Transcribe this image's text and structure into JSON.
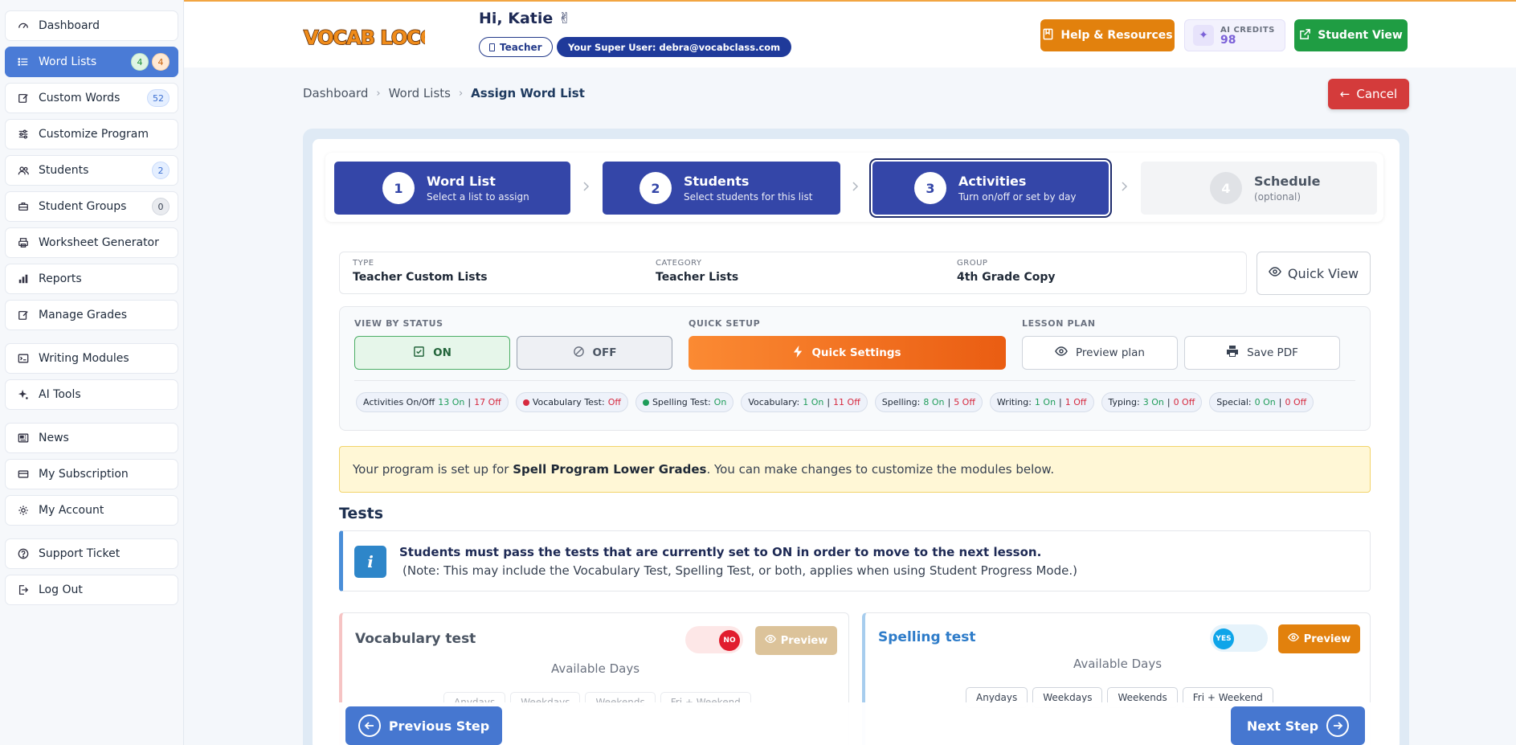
{
  "sidebar": {
    "items": [
      {
        "label": "Dashboard",
        "icon": "dashboard-icon"
      },
      {
        "label": "Word Lists",
        "icon": "list-icon",
        "badges": [
          "4",
          "4"
        ]
      },
      {
        "label": "Custom Words",
        "icon": "edit-icon",
        "badges": [
          "52"
        ]
      },
      {
        "label": "Customize Program",
        "icon": "sliders-icon"
      },
      {
        "label": "Students",
        "icon": "users-icon",
        "badges": [
          "2"
        ]
      },
      {
        "label": "Student Groups",
        "icon": "briefcase-icon",
        "badges": [
          "0"
        ]
      },
      {
        "label": "Worksheet Generator",
        "icon": "printer-icon"
      },
      {
        "label": "Reports",
        "icon": "bar-chart-icon"
      },
      {
        "label": "Manage Grades",
        "icon": "edit-icon"
      },
      {
        "label": "Writing Modules",
        "icon": "terminal-icon"
      },
      {
        "label": "AI Tools",
        "icon": "sparkle-icon"
      },
      {
        "label": "News",
        "icon": "newspaper-icon"
      },
      {
        "label": "My Subscription",
        "icon": "credit-card-icon"
      },
      {
        "label": "My Account",
        "icon": "gear-icon"
      },
      {
        "label": "Support Ticket",
        "icon": "question-icon"
      },
      {
        "label": "Log Out",
        "icon": "logout-icon"
      }
    ]
  },
  "header": {
    "logo_text": "VOCAB LOCO",
    "greeting": "Hi, Katie ✌",
    "role": "Teacher",
    "super_user": "Your Super User:  debra@vocabclass.com",
    "help_label": "Help & Resources",
    "credits_label": "AI CREDITS",
    "credits_value": "98",
    "student_view_label": "Student View"
  },
  "breadcrumb": [
    "Dashboard",
    "Word Lists",
    "Assign Word List"
  ],
  "cancel_label": "Cancel",
  "steps": [
    {
      "num": "1",
      "title": "Word List",
      "sub": "Select a list to assign"
    },
    {
      "num": "2",
      "title": "Students",
      "sub": "Select students for this list"
    },
    {
      "num": "3",
      "title": "Activities",
      "sub": "Turn on/off or set by day"
    },
    {
      "num": "4",
      "title": "Schedule",
      "sub": "(optional)"
    }
  ],
  "info": {
    "type_label": "TYPE",
    "type_value": "Teacher Custom Lists",
    "category_label": "CATEGORY",
    "category_value": "Teacher Lists",
    "group_label": "GROUP",
    "group_value": "4th Grade Copy",
    "quick_view_label": "Quick View"
  },
  "controls": {
    "view_status_label": "VIEW BY STATUS",
    "on_label": "ON",
    "off_label": "OFF",
    "quick_setup_label": "QUICK SETUP",
    "quick_settings_label": "Quick Settings",
    "lesson_plan_label": "LESSON PLAN",
    "preview_plan_label": "Preview plan",
    "save_pdf_label": "Save PDF"
  },
  "chips": [
    {
      "name": "Activities On/Off",
      "on": "13 On",
      "off": "17 Off"
    },
    {
      "name": "Vocabulary Test:",
      "status": "Off",
      "color": "#d6293f"
    },
    {
      "name": "Spelling Test:",
      "status": "On",
      "color": "#1f9d5a"
    },
    {
      "name": "Vocabulary:",
      "on": "1 On",
      "off": "11 Off"
    },
    {
      "name": "Spelling:",
      "on": "8 On",
      "off": "5 Off"
    },
    {
      "name": "Writing:",
      "on": "1 On",
      "off": "1 Off"
    },
    {
      "name": "Typing:",
      "on": "3 On",
      "off": "0 Off"
    },
    {
      "name": "Special:",
      "on": "0 On",
      "off": "0 Off"
    }
  ],
  "notice": {
    "prefix": "Your program is set up for ",
    "program": "Spell Program Lower Grades",
    "suffix": ". You can make changes to customize the modules below."
  },
  "tests_title": "Tests",
  "alert": {
    "line1": "Students must pass the tests that are currently set to ON in order to move to the next lesson.",
    "line2": "(Note: This may include the Vocabulary Test, Spelling Test, or both, applies when using Student Progress Mode.)"
  },
  "vocab_test": {
    "title": "Vocabulary test",
    "toggle": "NO",
    "preview": "Preview",
    "available": "Available Days",
    "days": [
      "Anydays",
      "Weekdays",
      "Weekends",
      "Fri + Weekend"
    ]
  },
  "spell_test": {
    "title": "Spelling test",
    "toggle": "YES",
    "preview": "Preview",
    "available": "Available Days",
    "days": [
      "Anydays",
      "Weekdays",
      "Weekends",
      "Fri + Weekend"
    ]
  },
  "prev_step_label": "Previous Step",
  "next_step_label": "Next Step",
  "colors": {
    "accent": "#3446a8",
    "orange": "#e2810d",
    "green": "#1f9d43",
    "red": "#d43b3b"
  }
}
